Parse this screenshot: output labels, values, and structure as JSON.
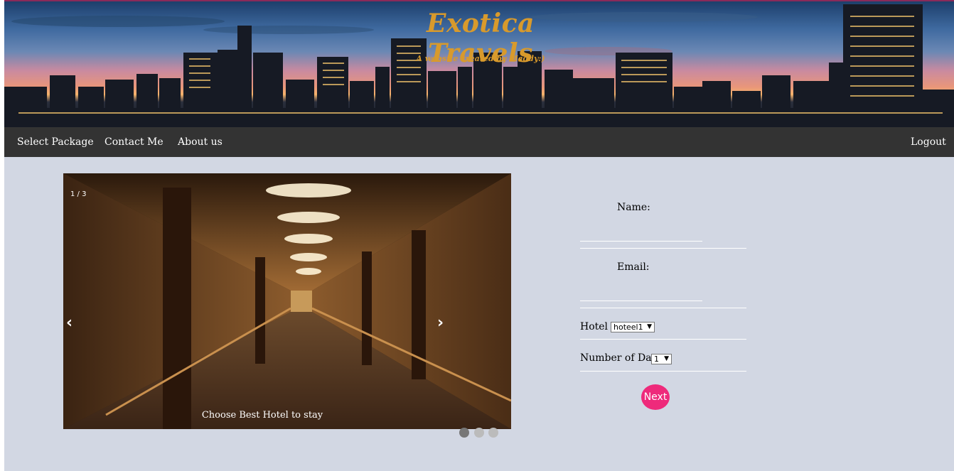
{
  "header": {
    "title": "Exotica Travels",
    "subtitle": "A website created by Maddy:)"
  },
  "nav": {
    "items": [
      {
        "label": "Select Package"
      },
      {
        "label": "Contact Me"
      },
      {
        "label": "About us"
      }
    ],
    "logout_label": "Logout"
  },
  "slideshow": {
    "counter": "1 / 3",
    "prev_icon": "‹",
    "next_icon": "›",
    "caption": "Choose Best Hotel to stay",
    "slide_count": 3,
    "active_index": 0
  },
  "form": {
    "name_label": "Name:",
    "name_value": "",
    "email_label": "Email:",
    "email_value": "",
    "hotel_label": "Hotel :",
    "hotel_selected": "hoteel1",
    "days_label": "Number of Days",
    "days_selected": "1",
    "next_label": "Next"
  },
  "colors": {
    "accent": "#ee2a7b",
    "title_gold": "#d89a2c",
    "nav_bg": "#333333",
    "page_bg": "#d2d7e3"
  }
}
